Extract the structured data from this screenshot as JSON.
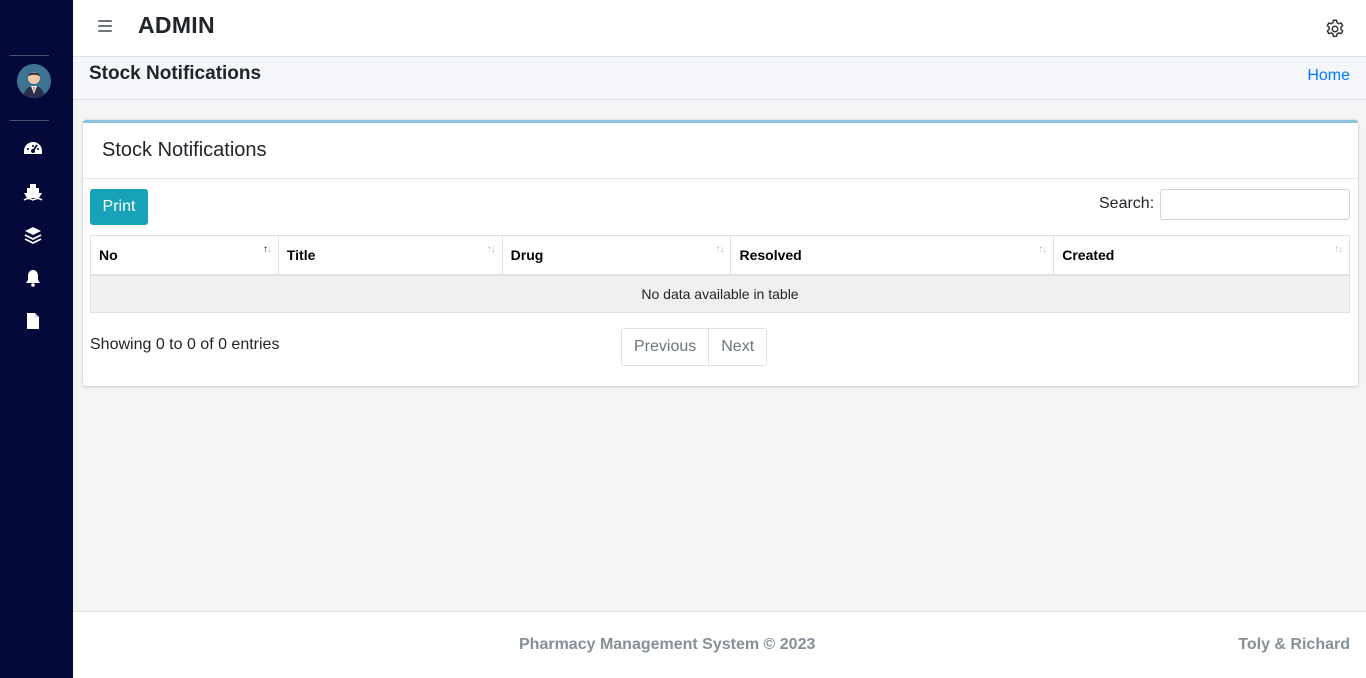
{
  "navbar": {
    "brand": "ADMIN",
    "menu_icon": "hamburger-menu-icon",
    "settings_icon": "gear-icon"
  },
  "sidebar": {
    "avatar": "user-avatar",
    "items": [
      {
        "icon": "dashboard-gauge-icon"
      },
      {
        "icon": "ship-icon"
      },
      {
        "icon": "layers-icon"
      },
      {
        "icon": "bell-icon"
      },
      {
        "icon": "file-icon"
      }
    ]
  },
  "header": {
    "title": "Stock Notifications",
    "breadcrumb_home": "Home"
  },
  "card": {
    "title": "Stock Notifications",
    "print_label": "Print",
    "search_label": "Search:",
    "search_value": "",
    "columns": [
      "No",
      "Title",
      "Drug",
      "Resolved",
      "Created"
    ],
    "empty_message": "No data available in table",
    "info": "Showing 0 to 0 of 0 entries",
    "pagination": {
      "previous": "Previous",
      "next": "Next"
    }
  },
  "footer": {
    "copyright": "Pharmacy Management System © 2023",
    "authors": "Toly & Richard"
  },
  "colors": {
    "sidebar_bg": "#05093a",
    "accent_button": "#17a2b8",
    "link": "#007bff",
    "card_top_border": "#8ec2dd"
  }
}
